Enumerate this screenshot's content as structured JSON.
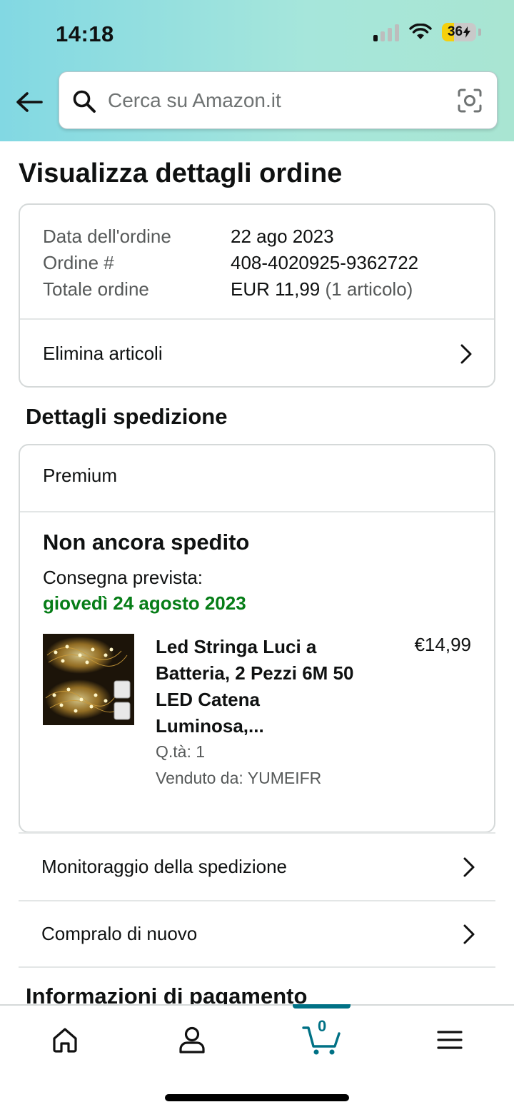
{
  "status_bar": {
    "time": "14:18",
    "battery": "36"
  },
  "search": {
    "placeholder": "Cerca su Amazon.it"
  },
  "page": {
    "title": "Visualizza dettagli ordine"
  },
  "order_summary": {
    "rows": [
      {
        "label": "Data dell'ordine",
        "value": "22 ago 2023",
        "extra": ""
      },
      {
        "label": "Ordine #",
        "value": "408-4020925-9362722",
        "extra": ""
      },
      {
        "label": "Totale ordine",
        "value": "EUR 11,99",
        "extra": "(1 articolo)"
      }
    ],
    "delete_items_label": "Elimina articoli"
  },
  "shipping": {
    "section_title": "Dettagli spedizione",
    "service": "Premium",
    "status": "Non ancora spedito",
    "delivery_label": "Consegna prevista:",
    "delivery_date": "giovedì 24 agosto 2023",
    "item": {
      "title": "Led Stringa Luci a Batteria, 2 Pezzi 6M 50 LED Catena Luminosa,...",
      "price": "€14,99",
      "quantity": "Q.tà: 1",
      "seller": "Venduto da: YUMEIFR"
    }
  },
  "actions": {
    "track_label": "Monitoraggio della spedizione",
    "buy_again_label": "Compralo di nuovo"
  },
  "payment": {
    "section_title": "Informazioni di pagamento"
  },
  "bottom_nav": {
    "cart_count": "0"
  },
  "colors": {
    "accent": "#007185",
    "delivery_green": "#067d17",
    "header_start": "#82d8e3",
    "header_end": "#a9e5d2"
  }
}
